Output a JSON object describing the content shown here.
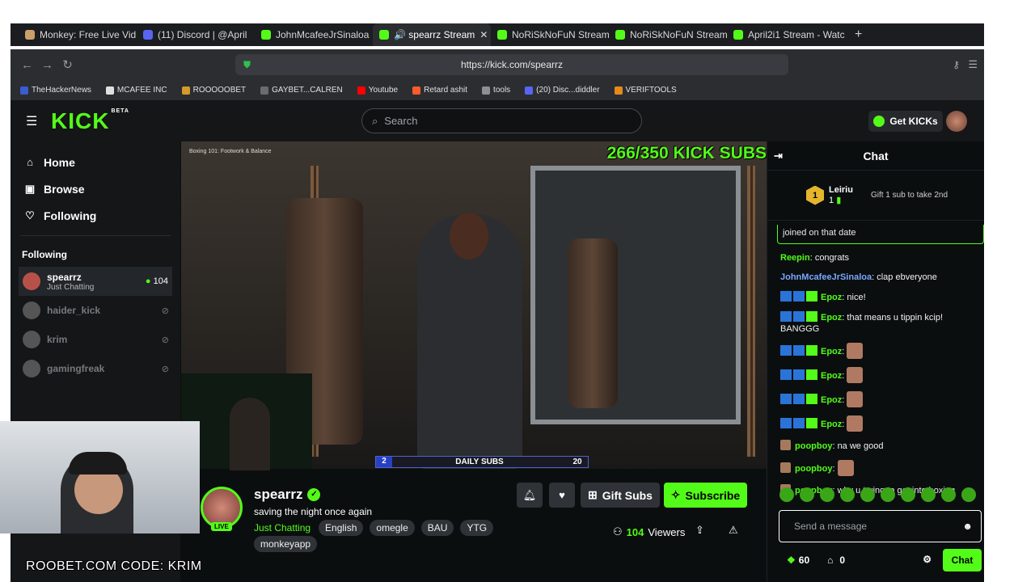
{
  "browser": {
    "tabs": [
      {
        "label": "Monkey: Free Live Vid",
        "color": "#c9a06a"
      },
      {
        "label": "(11) Discord | @April",
        "color": "#5865f2"
      },
      {
        "label": "JohnMcafeeJrSinaloa",
        "color": "#53fc18"
      },
      {
        "label": "🔊 spearrz Stream",
        "color": "#53fc18",
        "active": true
      },
      {
        "label": "NoRiSkNoFuN Stream",
        "color": "#53fc18"
      },
      {
        "label": "NoRiSkNoFuN Stream",
        "color": "#53fc18"
      },
      {
        "label": "April2i1 Stream - Watc",
        "color": "#53fc18"
      }
    ],
    "url": "https://kick.com/spearrz",
    "bookmarks": [
      "TheHackerNews",
      "MCAFEE INC",
      "ROOOOOBET",
      "GAYBET...CALREN",
      "Youtube",
      "Retard ashit",
      "tools",
      "(20) Disc...diddler",
      "VERIFTOOLS"
    ]
  },
  "kick": {
    "search_placeholder": "Search",
    "get_kicks": "Get KICKs",
    "nav": [
      "Home",
      "Browse",
      "Following"
    ],
    "following_heading": "Following",
    "following": [
      {
        "name": "spearrz",
        "sub": "Just Chatting",
        "viewers": "104",
        "live": true
      },
      {
        "name": "haider_kick",
        "live": false
      },
      {
        "name": "krim",
        "live": false
      },
      {
        "name": "gamingfreak",
        "live": false
      }
    ]
  },
  "video": {
    "overlay_title": "Boxing 101: Footwork & Balance",
    "sub_goal": "266/350 KICK SUBS",
    "daily_current": "2",
    "daily_label": "DAILY SUBS",
    "daily_goal": "20",
    "daily_progress": 0.1
  },
  "stream": {
    "name": "spearrz",
    "title": "saving the night once again",
    "category": "Just Chatting",
    "tags": [
      "English",
      "omegle",
      "BAU",
      "YTG"
    ],
    "tag_row2": "monkeyapp",
    "live_label": "LIVE",
    "gift_label": "Gift Subs",
    "subscribe_label": "Subscribe",
    "viewer_count": "104",
    "viewers_label": "Viewers"
  },
  "chat": {
    "title": "Chat",
    "top_gifter": {
      "rank": "1",
      "name": "Leiriu",
      "count": "1",
      "cta": "Gift 1 sub to take 2nd"
    },
    "pinned": "joined on that date",
    "messages": [
      {
        "user": "Reepin",
        "color": "#53fc18",
        "text": "congrats"
      },
      {
        "user": "JohnMcafeeJrSinaloa",
        "color": "#7aa7ff",
        "text": "clap ebveryone"
      },
      {
        "user": "Epoz",
        "color": "#53fc18",
        "text": "nice!",
        "badges": true
      },
      {
        "user": "Epoz",
        "color": "#53fc18",
        "text": "that means u tippin kcip! BANGGG",
        "badges": true
      },
      {
        "user": "Epoz",
        "color": "#53fc18",
        "text": "",
        "badges": true,
        "emote": true
      },
      {
        "user": "Epoz",
        "color": "#53fc18",
        "text": "",
        "badges": true,
        "emote": true
      },
      {
        "user": "Epoz",
        "color": "#53fc18",
        "text": "",
        "badges": true,
        "emote": true
      },
      {
        "user": "Epoz",
        "color": "#53fc18",
        "text": "",
        "badges": true,
        "emote": true
      },
      {
        "user": "poopboy",
        "color": "#53fc18",
        "text": "na we good",
        "avatar": true
      },
      {
        "user": "poopboy",
        "color": "#53fc18",
        "text": "",
        "avatar": true,
        "emote": true
      },
      {
        "user": "poopboy",
        "color": "#53fc18",
        "text": "why u trying to get into boxing",
        "avatar": true
      }
    ],
    "input_placeholder": "Send a message",
    "kicks_count": "60",
    "points_count": "0",
    "send_label": "Chat"
  },
  "promo": "ROOBET.COM CODE: KRIM"
}
